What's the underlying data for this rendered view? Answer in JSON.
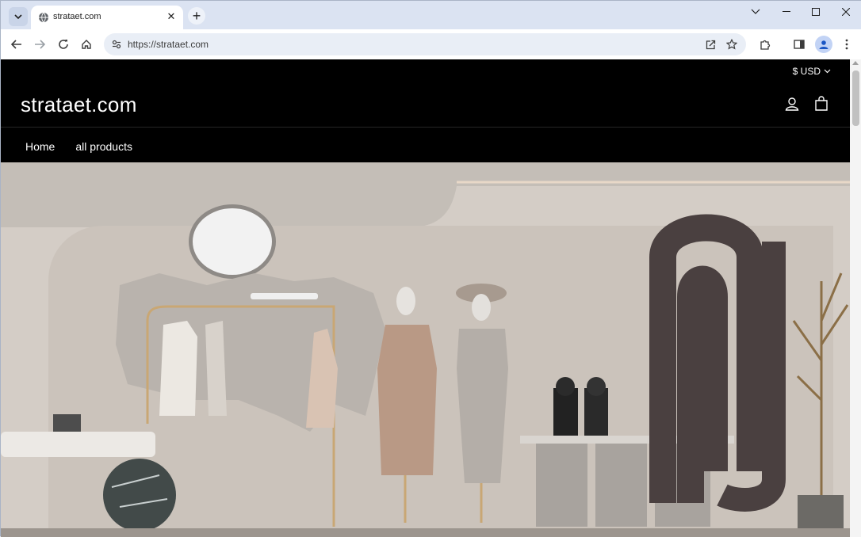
{
  "browser": {
    "tab": {
      "title": "strataet.com"
    },
    "url": "https://strataet.com"
  },
  "store": {
    "currency": "$ USD",
    "logo": "strataet.com",
    "nav": [
      {
        "label": "Home"
      },
      {
        "label": "all products"
      }
    ]
  },
  "colors": {
    "page_bg": "#000000",
    "chrome_bg": "#dfe6f3",
    "omnibox_bg": "#e9eef6"
  }
}
